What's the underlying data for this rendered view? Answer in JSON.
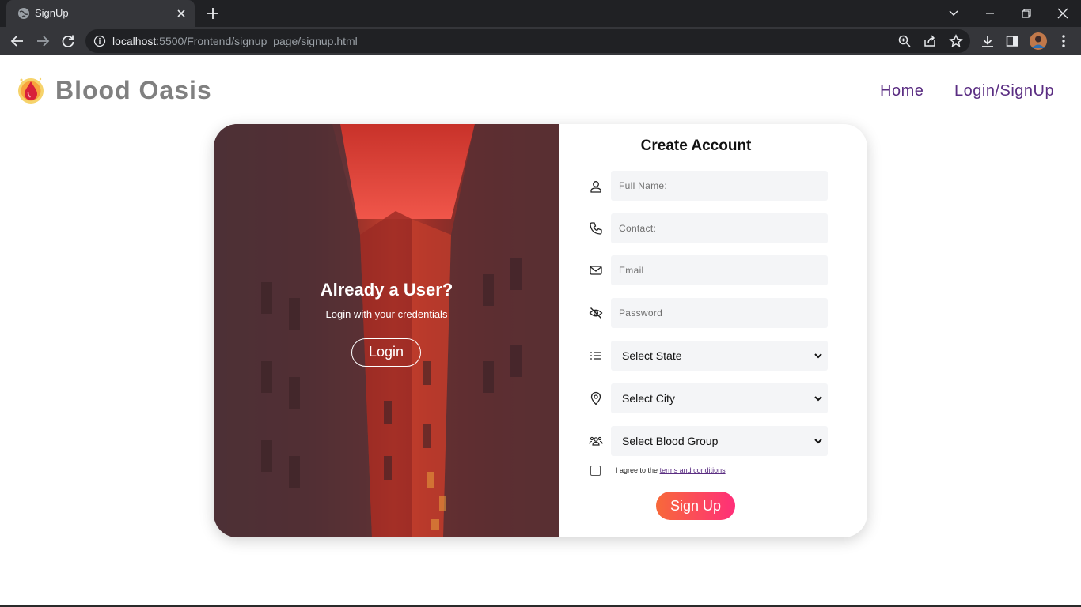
{
  "browser": {
    "tab_title": "SignUp",
    "url_host": "localhost",
    "url_path": ":5500/Frontend/signup_page/signup.html"
  },
  "header": {
    "brand": "Blood Oasis",
    "nav": {
      "home": "Home",
      "login_signup": "Login/SignUp"
    }
  },
  "left_panel": {
    "title": "Already a User?",
    "subtitle": "Login with your credentials",
    "login_button": "Login"
  },
  "form": {
    "title": "Create Account",
    "fields": {
      "full_name": "Full Name:",
      "contact": "Contact:",
      "email": "Email",
      "password": "Password"
    },
    "selects": {
      "state": "Select State",
      "city": "Select City",
      "blood_group": "Select Blood Group"
    },
    "terms_prefix": "I agree to the",
    "terms_link": "terms and conditions",
    "submit": "Sign Up"
  },
  "colors": {
    "nav_link": "#5a2d82",
    "button_gradient_start": "#f7693a",
    "button_gradient_end": "#ff2f79"
  }
}
